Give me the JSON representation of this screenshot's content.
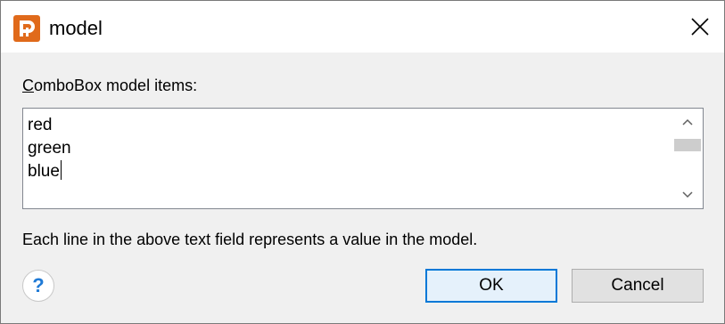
{
  "window": {
    "title": "model",
    "app_icon": "app-logo-icon",
    "close_icon": "close-icon"
  },
  "form": {
    "label_mnemonic": "C",
    "label_rest": "omboBox model items:",
    "items": [
      "red",
      "green",
      "blue"
    ],
    "description": "Each line in the above text field represents a value in the model."
  },
  "buttons": {
    "help_label": "?",
    "ok_label": "OK",
    "cancel_label": "Cancel"
  },
  "colors": {
    "accent": "#0078d7",
    "app_icon": "#e06a1b",
    "help": "#1f7ad6"
  }
}
